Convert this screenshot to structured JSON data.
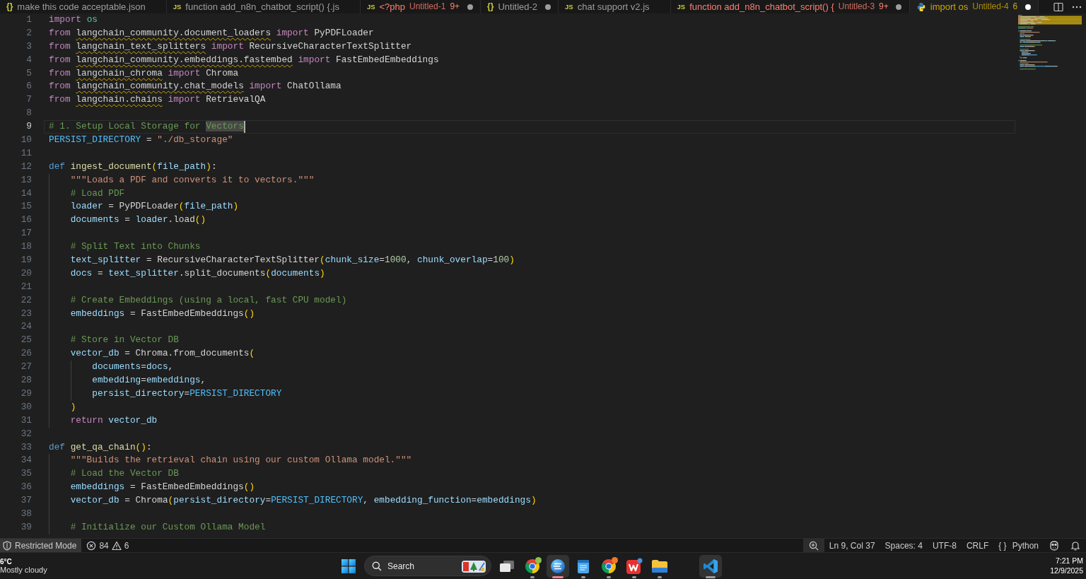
{
  "tabs": [
    {
      "kind": "json",
      "glyph": "{}",
      "label": "make this code acceptable.json",
      "has_errors": false,
      "has_warnings": false,
      "dirty": false,
      "selected": false
    },
    {
      "kind": "js",
      "glyph": "JS",
      "label": "function add_n8n_chatbot_script() {.js",
      "has_errors": false,
      "has_warnings": false,
      "dirty": false,
      "selected": false
    },
    {
      "kind": "js",
      "glyph": "JS",
      "label": "<?php",
      "description": "Untitled-1",
      "problems": "9+",
      "has_errors": true,
      "has_warnings": false,
      "dirty": true,
      "selected": false
    },
    {
      "kind": "json",
      "glyph": "{}",
      "label": "Untitled-2",
      "has_errors": false,
      "has_warnings": false,
      "dirty": true,
      "selected": false
    },
    {
      "kind": "js",
      "glyph": "JS",
      "label": "chat support v2.js",
      "has_errors": false,
      "has_warnings": false,
      "dirty": false,
      "selected": false
    },
    {
      "kind": "js",
      "glyph": "JS",
      "label": "function add_n8n_chatbot_script() {",
      "description": "Untitled-3",
      "problems": "9+",
      "has_errors": true,
      "has_warnings": false,
      "dirty": true,
      "selected": false
    },
    {
      "kind": "python",
      "label": "import os",
      "description": "Untitled-4",
      "problems": "6",
      "has_errors": false,
      "has_warnings": true,
      "dirty": true,
      "selected": true
    }
  ],
  "code": {
    "lines": [
      {
        "number": "1",
        "current": false,
        "tokens": [
          {
            "kind": "keyword",
            "text": "import "
          },
          {
            "kind": "module",
            "text": "os"
          }
        ]
      },
      {
        "number": "2",
        "current": false,
        "tokens": [
          {
            "kind": "keyword",
            "text": "from "
          },
          {
            "kind": "unresolved",
            "text": "langchain_community.document_loaders"
          },
          {
            "kind": "keyword",
            "text": " import"
          },
          {
            "kind": "plain",
            "text": " PyPDFLoader"
          }
        ]
      },
      {
        "number": "3",
        "current": false,
        "tokens": [
          {
            "kind": "keyword",
            "text": "from "
          },
          {
            "kind": "unresolved",
            "text": "langchain_text_splitters"
          },
          {
            "kind": "keyword",
            "text": " import"
          },
          {
            "kind": "plain",
            "text": " RecursiveCharacterTextSplitter"
          }
        ]
      },
      {
        "number": "4",
        "current": false,
        "tokens": [
          {
            "kind": "keyword",
            "text": "from "
          },
          {
            "kind": "unresolved",
            "text": "langchain_community.embeddings.fastembed"
          },
          {
            "kind": "keyword",
            "text": " import"
          },
          {
            "kind": "plain",
            "text": " FastEmbedEmbeddings"
          }
        ]
      },
      {
        "number": "5",
        "current": false,
        "tokens": [
          {
            "kind": "keyword",
            "text": "from "
          },
          {
            "kind": "unresolved",
            "text": "langchain_chroma"
          },
          {
            "kind": "keyword",
            "text": " import"
          },
          {
            "kind": "plain",
            "text": " Chroma"
          }
        ]
      },
      {
        "number": "6",
        "current": false,
        "tokens": [
          {
            "kind": "keyword",
            "text": "from "
          },
          {
            "kind": "unresolved",
            "text": "langchain_community.chat_models"
          },
          {
            "kind": "keyword",
            "text": " import"
          },
          {
            "kind": "plain",
            "text": " ChatOllama"
          }
        ]
      },
      {
        "number": "7",
        "current": false,
        "tokens": [
          {
            "kind": "keyword",
            "text": "from "
          },
          {
            "kind": "unresolved",
            "text": "langchain.chains"
          },
          {
            "kind": "keyword",
            "text": " import"
          },
          {
            "kind": "plain",
            "text": " RetrievalQA"
          }
        ]
      },
      {
        "number": "8",
        "current": false
      },
      {
        "number": "9",
        "current": true,
        "tokens": [
          {
            "kind": "comment",
            "text": "# 1. Setup Local Storage for ",
            "selected": false
          },
          {
            "kind": "comment",
            "text": "Vectors",
            "selected": true
          }
        ]
      },
      {
        "number": "10",
        "current": false,
        "tokens": [
          {
            "kind": "constant",
            "text": "PERSIST_DIRECTORY"
          },
          {
            "kind": "plain",
            "text": " = "
          },
          {
            "kind": "string",
            "text": "\"./db_storage\""
          }
        ]
      },
      {
        "number": "11",
        "current": false
      },
      {
        "number": "12",
        "current": false,
        "tokens": [
          {
            "kind": "storage",
            "text": "def "
          },
          {
            "kind": "function",
            "text": "ingest_document"
          },
          {
            "kind": "bracket",
            "text": "("
          },
          {
            "kind": "variable",
            "text": "file_path"
          },
          {
            "kind": "bracket",
            "text": ")"
          },
          {
            "kind": "plain",
            "text": ":"
          }
        ]
      },
      {
        "number": "13",
        "current": false,
        "tokens": [
          {
            "kind": "string",
            "text": "    \"\"\"Loads a PDF and converts it to vectors.\"\"\""
          }
        ]
      },
      {
        "number": "14",
        "current": false,
        "tokens": [
          {
            "kind": "comment",
            "text": "    # Load PDF"
          }
        ]
      },
      {
        "number": "15",
        "current": false,
        "tokens": [
          {
            "kind": "variable",
            "text": "    loader"
          },
          {
            "kind": "plain",
            "text": " = PyPDFLoader"
          },
          {
            "kind": "bracket",
            "text": "("
          },
          {
            "kind": "variable",
            "text": "file_path"
          },
          {
            "kind": "bracket",
            "text": ")"
          }
        ]
      },
      {
        "number": "16",
        "current": false,
        "tokens": [
          {
            "kind": "variable",
            "text": "    documents"
          },
          {
            "kind": "plain",
            "text": " = "
          },
          {
            "kind": "variable",
            "text": "loader"
          },
          {
            "kind": "plain",
            "text": ".load"
          },
          {
            "kind": "bracket",
            "text": "()"
          }
        ]
      },
      {
        "number": "17",
        "current": false
      },
      {
        "number": "18",
        "current": false,
        "tokens": [
          {
            "kind": "comment",
            "text": "    # Split Text into Chunks"
          }
        ]
      },
      {
        "number": "19",
        "current": false,
        "tokens": [
          {
            "kind": "variable",
            "text": "    text_splitter"
          },
          {
            "kind": "plain",
            "text": " = RecursiveCharacterTextSplitter"
          },
          {
            "kind": "bracket",
            "text": "("
          },
          {
            "kind": "variable",
            "text": "chunk_size"
          },
          {
            "kind": "plain",
            "text": "="
          },
          {
            "kind": "number",
            "text": "1000"
          },
          {
            "kind": "plain",
            "text": ", "
          },
          {
            "kind": "variable",
            "text": "chunk_overlap"
          },
          {
            "kind": "plain",
            "text": "="
          },
          {
            "kind": "number",
            "text": "100"
          },
          {
            "kind": "bracket",
            "text": ")"
          }
        ]
      },
      {
        "number": "20",
        "current": false,
        "tokens": [
          {
            "kind": "variable",
            "text": "    docs"
          },
          {
            "kind": "plain",
            "text": " = "
          },
          {
            "kind": "variable",
            "text": "text_splitter"
          },
          {
            "kind": "plain",
            "text": ".split_documents"
          },
          {
            "kind": "bracket",
            "text": "("
          },
          {
            "kind": "variable",
            "text": "documents"
          },
          {
            "kind": "bracket",
            "text": ")"
          }
        ]
      },
      {
        "number": "21",
        "current": false
      },
      {
        "number": "22",
        "current": false,
        "tokens": [
          {
            "kind": "comment",
            "text": "    # Create Embeddings (using a local, fast CPU model)"
          }
        ]
      },
      {
        "number": "23",
        "current": false,
        "tokens": [
          {
            "kind": "variable",
            "text": "    embeddings"
          },
          {
            "kind": "plain",
            "text": " = FastEmbedEmbeddings"
          },
          {
            "kind": "bracket",
            "text": "()"
          }
        ]
      },
      {
        "number": "24",
        "current": false
      },
      {
        "number": "25",
        "current": false,
        "tokens": [
          {
            "kind": "comment",
            "text": "    # Store in Vector DB"
          }
        ]
      },
      {
        "number": "26",
        "current": false,
        "tokens": [
          {
            "kind": "variable",
            "text": "    vector_db"
          },
          {
            "kind": "plain",
            "text": " = Chroma.from_documents"
          },
          {
            "kind": "bracket",
            "text": "("
          }
        ]
      },
      {
        "number": "27",
        "current": false,
        "tokens": [
          {
            "kind": "variable",
            "text": "        documents"
          },
          {
            "kind": "plain",
            "text": "="
          },
          {
            "kind": "variable",
            "text": "docs"
          },
          {
            "kind": "plain",
            "text": ","
          }
        ]
      },
      {
        "number": "28",
        "current": false,
        "tokens": [
          {
            "kind": "variable",
            "text": "        embedding"
          },
          {
            "kind": "plain",
            "text": "="
          },
          {
            "kind": "variable",
            "text": "embeddings"
          },
          {
            "kind": "plain",
            "text": ","
          }
        ]
      },
      {
        "number": "29",
        "current": false,
        "tokens": [
          {
            "kind": "variable",
            "text": "        persist_directory"
          },
          {
            "kind": "plain",
            "text": "="
          },
          {
            "kind": "constant",
            "text": "PERSIST_DIRECTORY"
          }
        ]
      },
      {
        "number": "30",
        "current": false,
        "tokens": [
          {
            "kind": "bracket",
            "text": "    )"
          }
        ]
      },
      {
        "number": "31",
        "current": false,
        "tokens": [
          {
            "kind": "keyword",
            "text": "    return"
          },
          {
            "kind": "variable",
            "text": " vector_db"
          }
        ]
      },
      {
        "number": "32",
        "current": false
      },
      {
        "number": "33",
        "current": false,
        "tokens": [
          {
            "kind": "storage",
            "text": "def "
          },
          {
            "kind": "function",
            "text": "get_qa_chain"
          },
          {
            "kind": "bracket",
            "text": "()"
          },
          {
            "kind": "plain",
            "text": ":"
          }
        ]
      },
      {
        "number": "34",
        "current": false,
        "tokens": [
          {
            "kind": "string",
            "text": "    \"\"\"Builds the retrieval chain using our custom Ollama model.\"\"\""
          }
        ]
      },
      {
        "number": "35",
        "current": false,
        "tokens": [
          {
            "kind": "comment",
            "text": "    # Load the Vector DB"
          }
        ]
      },
      {
        "number": "36",
        "current": false,
        "tokens": [
          {
            "kind": "variable",
            "text": "    embeddings"
          },
          {
            "kind": "plain",
            "text": " = FastEmbedEmbeddings"
          },
          {
            "kind": "bracket",
            "text": "()"
          }
        ]
      },
      {
        "number": "37",
        "current": false,
        "tokens": [
          {
            "kind": "variable",
            "text": "    vector_db"
          },
          {
            "kind": "plain",
            "text": " = Chroma"
          },
          {
            "kind": "bracket",
            "text": "("
          },
          {
            "kind": "variable",
            "text": "persist_directory"
          },
          {
            "kind": "plain",
            "text": "="
          },
          {
            "kind": "constant",
            "text": "PERSIST_DIRECTORY"
          },
          {
            "kind": "plain",
            "text": ", "
          },
          {
            "kind": "variable",
            "text": "embedding_function"
          },
          {
            "kind": "plain",
            "text": "="
          },
          {
            "kind": "variable",
            "text": "embeddings"
          },
          {
            "kind": "bracket",
            "text": ")"
          }
        ]
      },
      {
        "number": "38",
        "current": false
      },
      {
        "number": "39",
        "current": false,
        "tokens": [
          {
            "kind": "comment",
            "text": "    # Initialize our Custom Ollama Model"
          }
        ]
      }
    ]
  },
  "status_bar": {
    "restricted_mode": "Restricted Mode",
    "errors": "84",
    "warnings": "6",
    "items": [
      "Ln 9, Col 37",
      "Spaces: 4",
      "UTF-8",
      "CRLF"
    ],
    "language": {
      "glyph": "{ }",
      "label": "Python"
    }
  },
  "taskbar": {
    "weather": {
      "temperature": "6°C",
      "condition": "Mostly cloudy"
    },
    "search": {
      "placeholder": "Search"
    },
    "apps": [
      {
        "kind": "task-view",
        "running": false,
        "focused": false,
        "highlighted": false
      },
      {
        "kind": "browser",
        "color": "#8bc34a",
        "running": true,
        "focused": false,
        "highlighted": false
      },
      {
        "kind": "sphere",
        "running": true,
        "focused": true,
        "highlighted": true
      },
      {
        "kind": "notepad",
        "running": true,
        "focused": false,
        "highlighted": false
      },
      {
        "kind": "browser",
        "color": "#f0782c",
        "running": true,
        "focused": false,
        "highlighted": false
      },
      {
        "kind": "office",
        "running": true,
        "focused": false,
        "highlighted": false
      },
      {
        "kind": "folder",
        "running": true,
        "focused": false,
        "highlighted": false
      },
      {
        "kind": "editor",
        "running": true,
        "focused": false,
        "highlighted": true
      }
    ],
    "clock": {
      "time": "7:21 PM",
      "date": "12/9/2025"
    }
  }
}
